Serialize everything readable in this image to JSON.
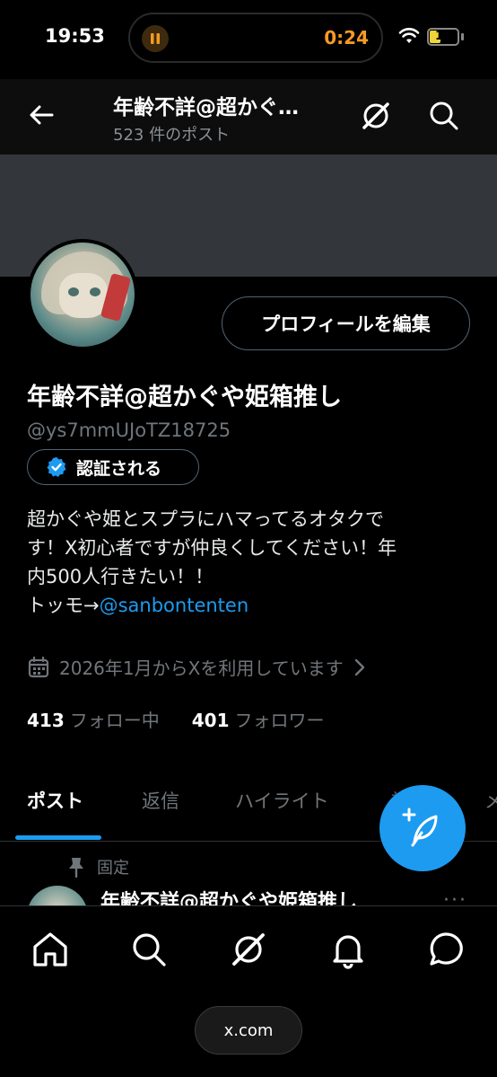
{
  "status": {
    "time": "19:53",
    "timer": "0:24",
    "battery": "17"
  },
  "header": {
    "title": "年齢不詳@超かぐ…",
    "post_count": "523 件のポスト"
  },
  "profile": {
    "edit_label": "プロフィールを編集",
    "display_name": "年齢不詳@超かぐや姫箱推し",
    "handle": "@ys7mmUJoTZ18725",
    "verify_label": "認証される",
    "bio_lines": [
      "超かぐや姫とスプラにハマってるオタクで",
      "す！X初心者ですが仲良くしてください！年",
      "内500人行きたい！！"
    ],
    "bio_link_prefix": "トッモ→",
    "bio_link": "@sanbontenten",
    "joined": "2026年1月からXを利用しています",
    "following_count": "413",
    "following_label": "フォロー中",
    "followers_count": "401",
    "followers_label": "フォロワー"
  },
  "tabs": {
    "posts": "ポスト",
    "replies": "返信",
    "highlights": "ハイライト",
    "more1": "記",
    "more2": "メ"
  },
  "pinned": {
    "label": "固定",
    "author": "年齢不詳@超かぐや姫箱推し",
    "more": "···"
  },
  "bottom": {
    "url": "x.com"
  },
  "colors": {
    "accent": "#1d9bf0",
    "background": "#000000",
    "banner": "#33363a"
  }
}
